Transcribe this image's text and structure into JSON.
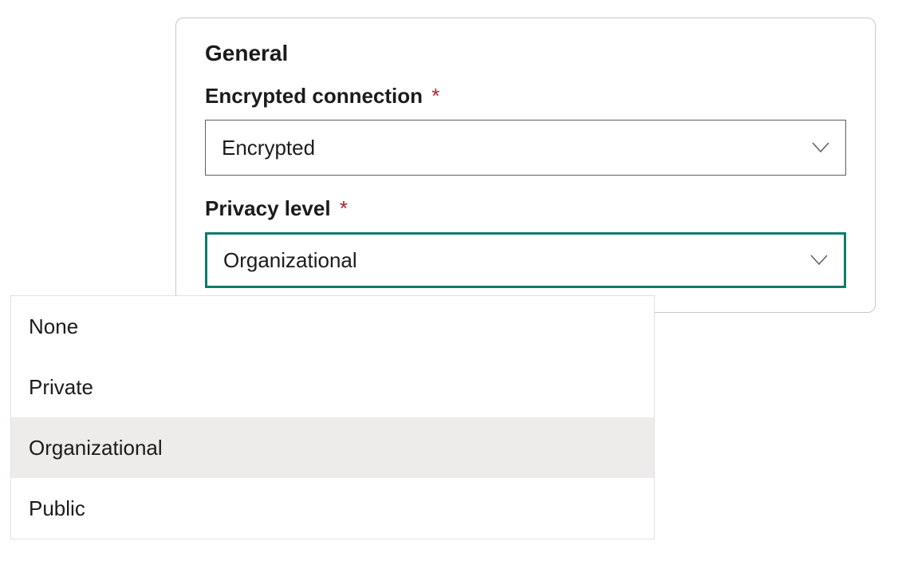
{
  "section": {
    "title": "General"
  },
  "encrypted_connection": {
    "label": "Encrypted connection",
    "required_mark": "*",
    "value": "Encrypted"
  },
  "privacy_level": {
    "label": "Privacy level",
    "required_mark": "*",
    "value": "Organizational",
    "options": [
      "None",
      "Private",
      "Organizational",
      "Public"
    ],
    "selected_index": 2
  },
  "colors": {
    "active_border": "#0f7b6c",
    "required": "#a4262c",
    "option_selected_bg": "#edecea"
  }
}
